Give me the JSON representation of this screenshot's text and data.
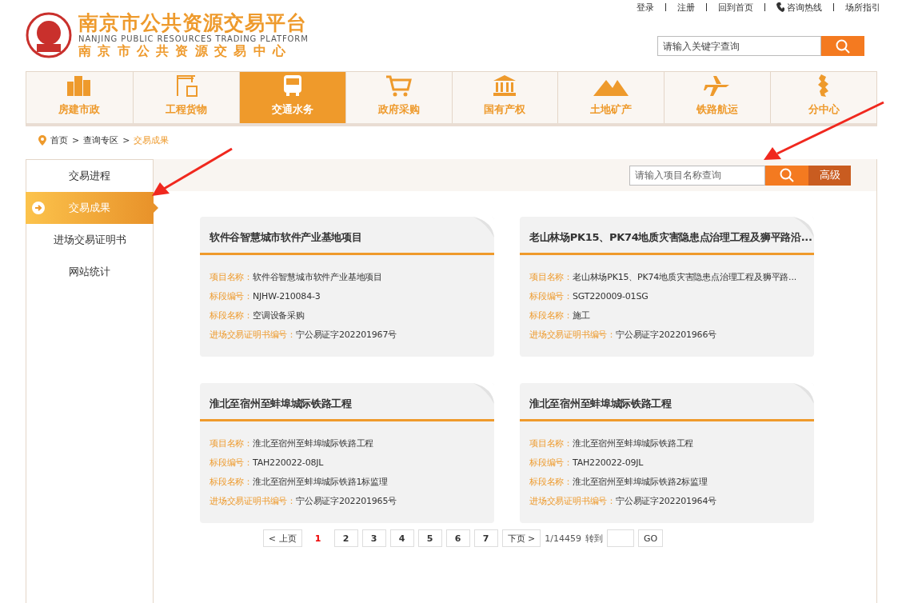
{
  "header": {
    "title": "南京市公共资源交易平台",
    "subtitle_en": "NANJING PUBLIC RESOURCES TRADING PLATFORM",
    "subtitle_cn": "南京市公共资源交易中心",
    "top_links": [
      "登录",
      "注册",
      "回到首页",
      "咨询热线",
      "场所指引"
    ],
    "search": {
      "placeholder": "请输入关键字查询"
    }
  },
  "nav": [
    {
      "label": "房建市政",
      "selected": false
    },
    {
      "label": "工程货物",
      "selected": false
    },
    {
      "label": "交通水务",
      "selected": true
    },
    {
      "label": "政府采购",
      "selected": false
    },
    {
      "label": "国有产权",
      "selected": false
    },
    {
      "label": "土地矿产",
      "selected": false
    },
    {
      "label": "铁路航运",
      "selected": false
    },
    {
      "label": "分中心",
      "selected": false
    }
  ],
  "breadcrumb": [
    {
      "kind": "link",
      "text": "首页"
    },
    {
      "kind": "separator",
      "text": ">"
    },
    {
      "kind": "link",
      "text": "查询专区"
    },
    {
      "kind": "separator",
      "text": ">"
    },
    {
      "kind": "current",
      "text": "交易成果"
    }
  ],
  "sidebar": [
    {
      "label": "交易进程",
      "selected": false
    },
    {
      "label": "交易成果",
      "selected": true
    },
    {
      "label": "进场交易证明书",
      "selected": false
    },
    {
      "label": "网站统计",
      "selected": false
    }
  ],
  "project_search": {
    "placeholder": "请输入项目名称查询",
    "advanced": "高级"
  },
  "cards": [
    {
      "title": "软件谷智慧城市软件产业基地项目",
      "fields": [
        {
          "label": "项目名称：",
          "value": "软件谷智慧城市软件产业基地项目"
        },
        {
          "label": "标段编号：",
          "value": "NJHW-210084-3"
        },
        {
          "label": "标段名称：",
          "value": "空调设备采购"
        },
        {
          "label": "进场交易证明书编号：",
          "value": "宁公易证字202201967号"
        }
      ]
    },
    {
      "title": "老山林场PK15、PK74地质灾害隐患点治理工程及狮平路沿...",
      "fields": [
        {
          "label": "项目名称：",
          "value": "老山林场PK15、PK74地质灾害隐患点治理工程及狮平路..."
        },
        {
          "label": "标段编号：",
          "value": "SGT220009-01SG"
        },
        {
          "label": "标段名称：",
          "value": "施工"
        },
        {
          "label": "进场交易证明书编号：",
          "value": "宁公易证字202201966号"
        }
      ]
    },
    {
      "title": "淮北至宿州至蚌埠城际铁路工程",
      "fields": [
        {
          "label": "项目名称：",
          "value": "淮北至宿州至蚌埠城际铁路工程"
        },
        {
          "label": "标段编号：",
          "value": "TAH220022-08JL"
        },
        {
          "label": "标段名称：",
          "value": "淮北至宿州至蚌埠城际铁路1标监理"
        },
        {
          "label": "进场交易证明书编号：",
          "value": "宁公易证字202201965号"
        }
      ]
    },
    {
      "title": "淮北至宿州至蚌埠城际铁路工程",
      "fields": [
        {
          "label": "项目名称：",
          "value": "淮北至宿州至蚌埠城际铁路工程"
        },
        {
          "label": "标段编号：",
          "value": "TAH220022-09JL"
        },
        {
          "label": "标段名称：",
          "value": "淮北至宿州至蚌埠城际铁路2标监理"
        },
        {
          "label": "进场交易证明书编号：",
          "value": "宁公易证字202201964号"
        }
      ]
    }
  ],
  "pagination": {
    "prev": "< 上页",
    "pages": [
      {
        "label": "1",
        "selected": true
      },
      {
        "label": "2",
        "selected": false
      },
      {
        "label": "3",
        "selected": false
      },
      {
        "label": "4",
        "selected": false
      },
      {
        "label": "5",
        "selected": false
      },
      {
        "label": "6",
        "selected": false
      },
      {
        "label": "7",
        "selected": false
      }
    ],
    "next": "下页 >",
    "total": "1/14459",
    "goto_label": "转到",
    "go": "GO"
  }
}
